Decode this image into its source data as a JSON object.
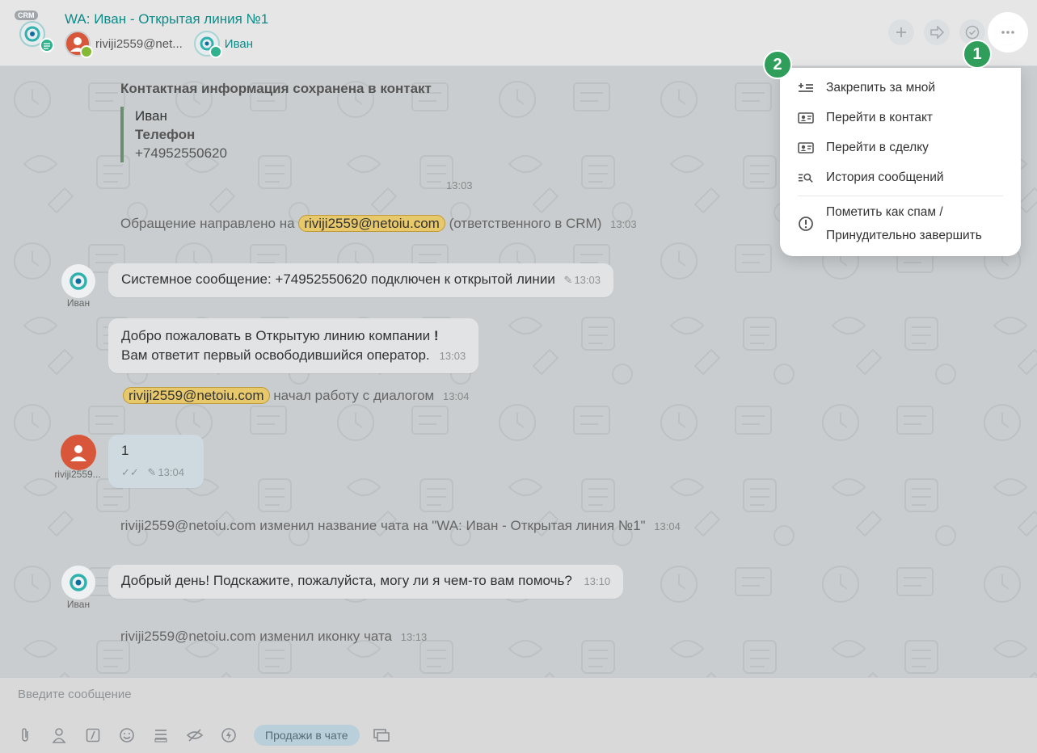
{
  "header": {
    "crm_badge": "CRM",
    "title": "WA: Иван - Открытая линия №1",
    "members": [
      {
        "name": "riviji2559@net..."
      },
      {
        "name": "Иван"
      }
    ],
    "buttons": [
      "add",
      "forward",
      "finish",
      "more"
    ]
  },
  "menu": {
    "items": [
      {
        "label": "Закрепить за мной",
        "icon": "pin-list-icon"
      },
      {
        "label": "Перейти в контакт",
        "icon": "contact-card-icon"
      },
      {
        "label": "Перейти в сделку",
        "icon": "deal-card-icon"
      },
      {
        "label": "История сообщений",
        "icon": "history-search-icon"
      }
    ],
    "spam_line1": "Пометить как спам /",
    "spam_line2": "Принудительно завершить"
  },
  "callouts": {
    "one": "1",
    "two": "2"
  },
  "messages": {
    "contact_saved": {
      "title": "Контактная информация сохранена в контакт",
      "name": "Иван",
      "phone_label": "Телефон",
      "phone": "+74952550620",
      "time": "13:03"
    },
    "redirect": {
      "prefix": "Обращение направлено на",
      "mention": "riviji2559@netoiu.com",
      "suffix": "(ответственного в CRM)",
      "time": "13:03"
    },
    "sys_connected": {
      "author": "Иван",
      "text": "Системное сообщение: +74952550620 подключен к открытой линии",
      "time": "13:03"
    },
    "welcome": {
      "line1": "Добро пожаловать в Открытую линию компании",
      "excl": "!",
      "line2": "Вам ответит первый освободившийся оператор.",
      "time": "13:03"
    },
    "started": {
      "mention": "riviji2559@netoiu.com",
      "text": "начал работу с диалогом",
      "time": "13:04"
    },
    "user_msg": {
      "author": "riviji2559...",
      "text": "1",
      "time": "13:04"
    },
    "renamed": {
      "text": "riviji2559@netoiu.com изменил название чата на \"WA: Иван - Открытая линия №1\"",
      "time": "13:04"
    },
    "greeting": {
      "author": "Иван",
      "text": "Добрый день! Подскажите, пожалуйста, могу ли я чем-то вам помочь?",
      "time": "13:10"
    },
    "icon_changed": {
      "text": "riviji2559@netoiu.com изменил иконку чата",
      "time": "13:13"
    }
  },
  "input": {
    "placeholder": "Введите сообщение",
    "sales_tag": "Продажи в чате"
  }
}
